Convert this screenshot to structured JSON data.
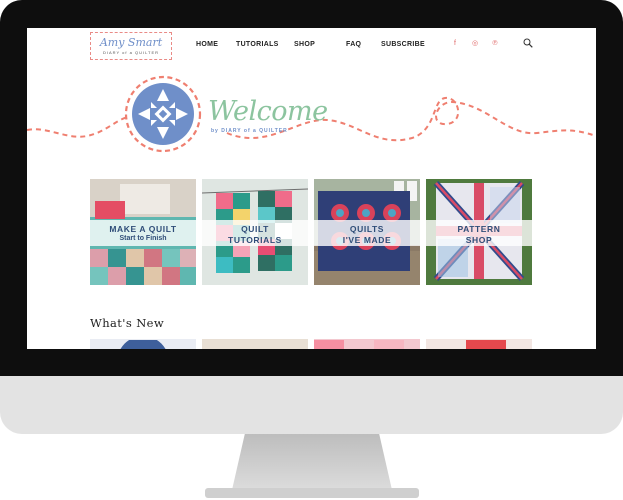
{
  "logo": {
    "script": "Amy Smart",
    "sub": "DIARY of a QUILTER"
  },
  "nav": [
    "HOME",
    "TUTORIALS",
    "SHOP",
    "FAQ",
    "SUBSCRIBE"
  ],
  "social": [
    {
      "icon": "facebook-icon",
      "glyph": "f"
    },
    {
      "icon": "instagram-icon",
      "glyph": "◎"
    },
    {
      "icon": "pinterest-icon",
      "glyph": "℗"
    }
  ],
  "welcome": {
    "title": "Welcome",
    "sub": "by DIARY of a QUILTER"
  },
  "tiles": [
    {
      "line1": "MAKE A QUILT",
      "line2": "Start to Finish"
    },
    {
      "line1": "QUILT",
      "line2": "TUTORIALS"
    },
    {
      "line1": "QUILTS",
      "line2": "I'VE MADE"
    },
    {
      "line1": "PATTERN",
      "line2": "SHOP"
    }
  ],
  "section_title": "What's New",
  "colors": {
    "accent_coral": "#ef7f70",
    "brand_blue": "#6f8fc9",
    "welcome_green": "#8cc49f",
    "tile_text": "#2f4d78"
  }
}
